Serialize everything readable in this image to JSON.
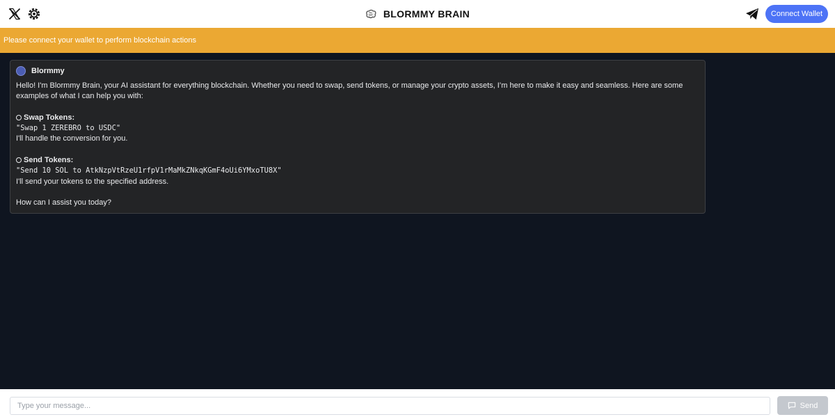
{
  "header": {
    "title": "BLORMMY BRAIN",
    "icons": {
      "left_1": "x-logo-icon",
      "left_2": "gear-icon",
      "brand": "brain-icon",
      "right": "telegram-icon"
    },
    "connect_label": "Connect Wallet"
  },
  "banner": {
    "text": "Please connect your wallet to perform blockchain actions",
    "color": "#eba833"
  },
  "message": {
    "sender": "Blormmy",
    "intro": "Hello! I'm Blormmy Brain, your AI assistant for everything blockchain. Whether you need to swap, send tokens, or manage your crypto assets, I’m here to make it easy and seamless. Here are some examples of what I can help you with:",
    "items": [
      {
        "title": "Swap Tokens:",
        "command": "\"Swap 1 ZEREBRO to USDC\"",
        "note": "I'll handle the conversion for you."
      },
      {
        "title": "Send Tokens:",
        "command": "\"Send 10 SOL to AtkNzpVtRzeU1rfpV1rMaMkZNkqKGmF4oUi6YMxoTU8X\"",
        "note": "I'll send your tokens to the specified address."
      }
    ],
    "closing": "How can I assist you today?"
  },
  "composer": {
    "placeholder": "Type your message...",
    "send_label": "Send"
  },
  "colors": {
    "background": "#0f1520",
    "accent_button": "#4d73f6",
    "message_bg": "#232426",
    "send_disabled": "#c4c8ce"
  }
}
